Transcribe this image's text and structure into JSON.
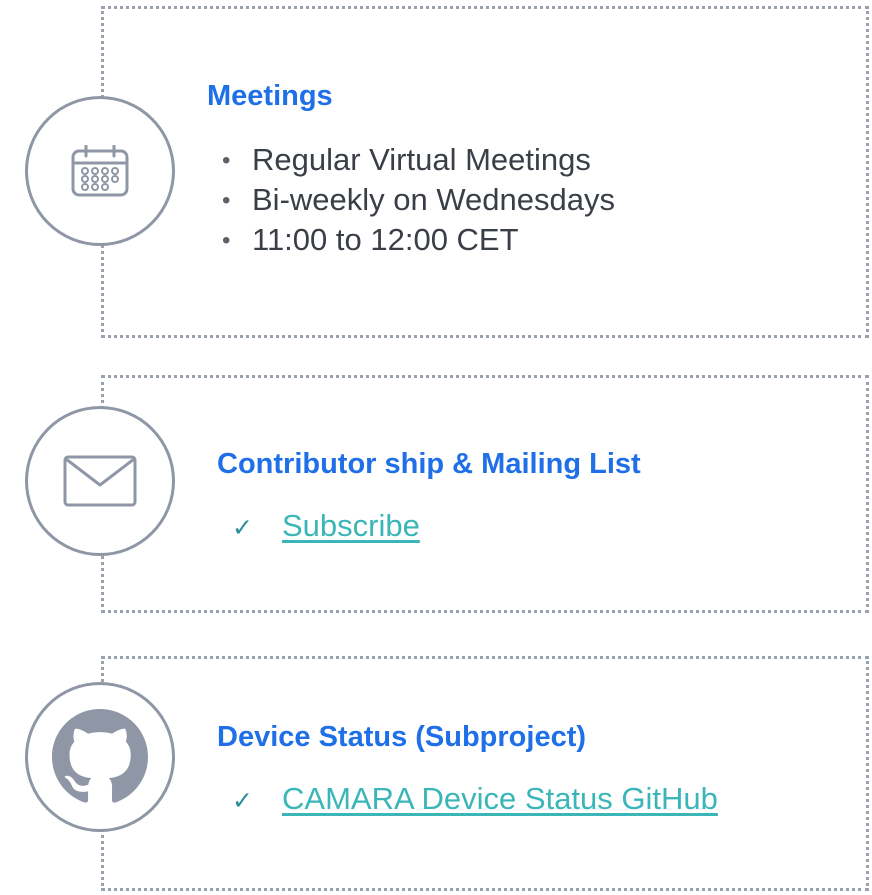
{
  "meetings": {
    "title": "Meetings",
    "icon": "calendar-icon",
    "items": [
      "Regular Virtual Meetings",
      "Bi-weekly on Wednesdays",
      "11:00 to 12:00 CET"
    ],
    "bullet": "•"
  },
  "contributorship": {
    "title": "Contributor ship & Mailing List",
    "icon": "envelope-icon",
    "check": "✓",
    "link_label": "Subscribe"
  },
  "device_status": {
    "title": "Device Status (Subproject)",
    "icon": "github-icon",
    "check": "✓",
    "link_label": "CAMARA Device Status GitHub"
  },
  "colors": {
    "heading": "#1e6fe8",
    "link": "#3bb6b8",
    "icon": "#8f97a6",
    "text": "#3a3f47"
  }
}
